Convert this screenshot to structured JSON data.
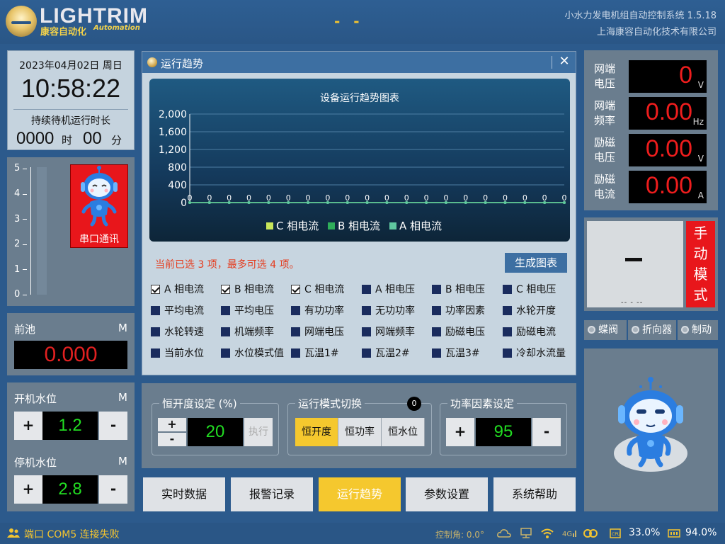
{
  "header": {
    "brand_en": "LIGHTRIM",
    "brand_cn": "康容自动化",
    "brand_tag": "Automation",
    "center_mark": "- -",
    "system_title": "小水力发电机组自动控制系统 1.5.18",
    "company": "上海康容自动化技术有限公司"
  },
  "time_panel": {
    "date": "2023年04月02日 周日",
    "clock": "10:58:22",
    "standby_label": "持续待机运行时长",
    "standby_hours": "0000",
    "hours_unit": "时",
    "standby_minutes": "00",
    "minutes_unit": "分"
  },
  "gauge": {
    "ticks": [
      "5",
      "4",
      "3",
      "2",
      "1",
      "0"
    ],
    "level": 0,
    "card_label": "串口通讯"
  },
  "forebay": {
    "label": "前池",
    "unit": "M",
    "value": "0.000"
  },
  "levels": {
    "start": {
      "label": "开机水位",
      "unit": "M",
      "value": "1.2"
    },
    "stop": {
      "label": "停机水位",
      "unit": "M",
      "value": "2.8"
    },
    "plus": "+",
    "minus": "-"
  },
  "trend": {
    "title": "运行趋势",
    "close": "✕",
    "select_hint": "当前已选 3 项，最多可选 4 项。",
    "generate_button": "生成图表",
    "options": [
      {
        "label": "A 相电流",
        "checked": true
      },
      {
        "label": "B 相电流",
        "checked": true
      },
      {
        "label": "C 相电流",
        "checked": true
      },
      {
        "label": "A 相电压",
        "checked": false
      },
      {
        "label": "B 相电压",
        "checked": false
      },
      {
        "label": "C 相电压",
        "checked": false
      },
      {
        "label": "平均电流",
        "checked": false
      },
      {
        "label": "平均电压",
        "checked": false
      },
      {
        "label": "有功功率",
        "checked": false
      },
      {
        "label": "无功功率",
        "checked": false
      },
      {
        "label": "功率因素",
        "checked": false
      },
      {
        "label": "水轮开度",
        "checked": false
      },
      {
        "label": "水轮转速",
        "checked": false
      },
      {
        "label": "机端频率",
        "checked": false
      },
      {
        "label": "网端电压",
        "checked": false
      },
      {
        "label": "网端频率",
        "checked": false
      },
      {
        "label": "励磁电压",
        "checked": false
      },
      {
        "label": "励磁电流",
        "checked": false
      },
      {
        "label": "当前水位",
        "checked": false
      },
      {
        "label": "水位模式值",
        "checked": false
      },
      {
        "label": "瓦温1#",
        "checked": false
      },
      {
        "label": "瓦温2#",
        "checked": false
      },
      {
        "label": "瓦温3#",
        "checked": false
      },
      {
        "label": "冷却水流量",
        "checked": false
      }
    ]
  },
  "chart_data": {
    "type": "line",
    "title": "设备运行趋势图表",
    "xlabel": "",
    "ylabel": "",
    "ylim": [
      0,
      2000
    ],
    "yticks": [
      "2,000",
      "1,600",
      "1,200",
      "800",
      "400",
      "0"
    ],
    "grid": true,
    "legend_position": "bottom",
    "series": [
      {
        "name": "C 相电流",
        "color": "#c8e65a",
        "values": [
          0,
          0,
          0,
          0,
          0,
          0,
          0,
          0,
          0,
          0,
          0,
          0,
          0,
          0,
          0,
          0,
          0,
          0,
          0,
          0
        ]
      },
      {
        "name": "B 相电流",
        "color": "#2fae5a",
        "values": [
          0,
          0,
          0,
          0,
          0,
          0,
          0,
          0,
          0,
          0,
          0,
          0,
          0,
          0,
          0,
          0,
          0,
          0,
          0,
          0
        ]
      },
      {
        "name": "A 相电流",
        "color": "#5fc7a0",
        "values": [
          0,
          0,
          0,
          0,
          0,
          0,
          0,
          0,
          0,
          0,
          0,
          0,
          0,
          0,
          0,
          0,
          0,
          0,
          0,
          0
        ]
      }
    ]
  },
  "controls": {
    "opening": {
      "title": "恒开度设定 (%)",
      "value": "20",
      "exec_label": "执行"
    },
    "mode": {
      "title": "运行模式切换",
      "badge": "0",
      "options": [
        "恒开度",
        "恒功率",
        "恒水位"
      ],
      "selected": 0
    },
    "pf": {
      "title": "功率因素设定",
      "value": "95"
    }
  },
  "nav": {
    "items": [
      "实时数据",
      "报警记录",
      "运行趋势",
      "参数设置",
      "系统帮助"
    ],
    "active": 2
  },
  "readings": [
    {
      "label": "网端电压",
      "value": "0",
      "unit": "V"
    },
    {
      "label": "网端频率",
      "value": "0.00",
      "unit": "Hz"
    },
    {
      "label": "励磁电压",
      "value": "0.00",
      "unit": "V"
    },
    {
      "label": "励磁电流",
      "value": "0.00",
      "unit": "A"
    }
  ],
  "mode_display": {
    "main": "-",
    "sub": "-- - --",
    "manual_label": "手动模式"
  },
  "indicators": [
    "蝶阀",
    "折向器",
    "制动"
  ],
  "status": {
    "port_text": "端口 COM5 连接失败",
    "angle": "控制角: 0.0°",
    "cpu": "33.0%",
    "memory": "94.0%"
  },
  "colors": {
    "accent_yellow": "#f5c82e",
    "alarm_red": "#e8161b",
    "value_green": "#22dd22",
    "title_blue": "#3d6fa2"
  }
}
